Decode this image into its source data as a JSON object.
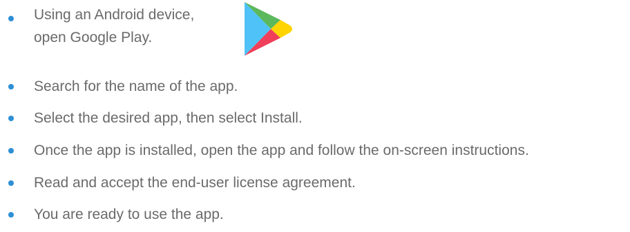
{
  "steps": {
    "first": {
      "line1": "Using an Android device,",
      "line2": "open Google Play."
    },
    "items": [
      "Search for the name of the app.",
      "Select the desired app, then select Install.",
      "Once the app is installed, open the app and follow the on-screen instructions.",
      "Read and accept the end-user license agreement.",
      "You are ready to use the app."
    ]
  },
  "logo": {
    "icon": "google-play-icon",
    "colors": {
      "blue": "#4fc3f7",
      "green": "#5cb85c",
      "yellow": "#ffd400",
      "red": "#ef3f5b"
    }
  },
  "bullet_color": "#2d8fd5"
}
